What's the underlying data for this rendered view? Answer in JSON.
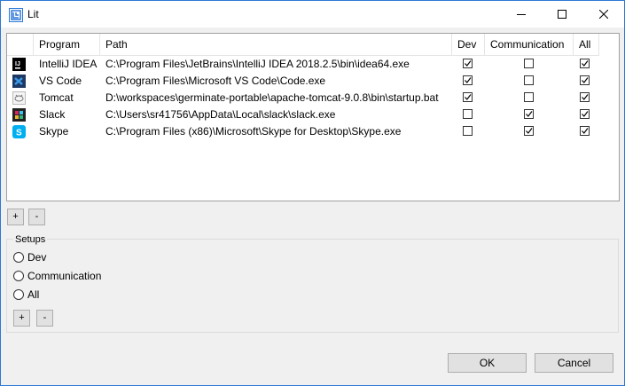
{
  "window": {
    "title": "Lit"
  },
  "table": {
    "columns": [
      "Program",
      "Path",
      "Dev",
      "Communication",
      "All"
    ],
    "rows": [
      {
        "icon": "intellij-icon",
        "program": "IntelliJ IDEA",
        "path": "C:\\Program Files\\JetBrains\\IntelliJ IDEA 2018.2.5\\bin\\idea64.exe",
        "dev": true,
        "communication": false,
        "all": true
      },
      {
        "icon": "vscode-icon",
        "program": "VS Code",
        "path": "C:\\Program Files\\Microsoft VS Code\\Code.exe",
        "dev": true,
        "communication": false,
        "all": true
      },
      {
        "icon": "tomcat-icon",
        "program": "Tomcat",
        "path": "D:\\workspaces\\germinate-portable\\apache-tomcat-9.0.8\\bin\\startup.bat",
        "dev": true,
        "communication": false,
        "all": true
      },
      {
        "icon": "slack-icon",
        "program": "Slack",
        "path": "C:\\Users\\sr41756\\AppData\\Local\\slack\\slack.exe",
        "dev": false,
        "communication": true,
        "all": true
      },
      {
        "icon": "skype-icon",
        "program": "Skype",
        "path": "C:\\Program Files (x86)\\Microsoft\\Skype for Desktop\\Skype.exe",
        "dev": false,
        "communication": true,
        "all": true
      }
    ]
  },
  "program_buttons": {
    "add": "+",
    "remove": "-"
  },
  "setups": {
    "label": "Setups",
    "options": [
      "Dev",
      "Communication",
      "All"
    ],
    "add": "+",
    "remove": "-"
  },
  "dialog_buttons": {
    "ok": "OK",
    "cancel": "Cancel"
  },
  "colors": {
    "title_border": "#2b79d8",
    "checkbox_border": "#333333"
  }
}
